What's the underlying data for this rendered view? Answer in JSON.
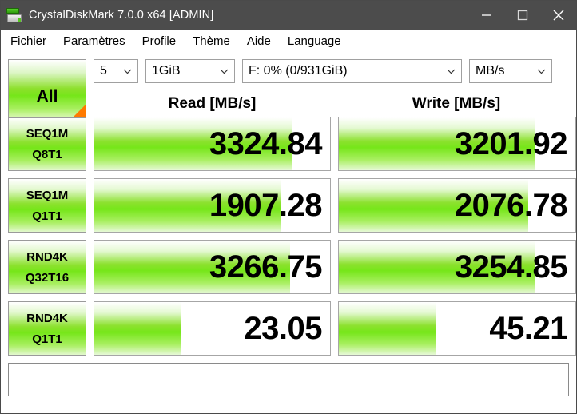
{
  "window": {
    "title": "CrystalDiskMark 7.0.0 x64 [ADMIN]",
    "icon": "disk-drive-icon",
    "controls": {
      "minimize": "minimize-icon",
      "maximize": "maximize-icon",
      "close": "close-icon"
    },
    "titlebar_color": "#4c4c4c"
  },
  "menu": {
    "items": [
      {
        "accel": "F",
        "rest": "ichier"
      },
      {
        "accel": "P",
        "rest": "aramètres"
      },
      {
        "accel": "P",
        "rest": "rofile"
      },
      {
        "accel": "T",
        "rest": "hème"
      },
      {
        "accel": "A",
        "rest": "ide"
      },
      {
        "accel": "L",
        "rest": "anguage"
      }
    ]
  },
  "toolbar": {
    "all_button": "All",
    "runs": "5",
    "test_size": "1GiB",
    "drive": "F: 0% (0/931GiB)",
    "unit": "MB/s"
  },
  "columns": {
    "read": "Read [MB/s]",
    "write": "Write [MB/s]"
  },
  "accent": {
    "green": "#76e619",
    "orange": "#ff7a00"
  },
  "results": [
    {
      "test": "SEQ1M",
      "queue": "Q8T1",
      "read": "3324.84",
      "write": "3201.92",
      "read_fill_pct": 84,
      "write_fill_pct": 83
    },
    {
      "test": "SEQ1M",
      "queue": "Q1T1",
      "read": "1907.28",
      "write": "2076.78",
      "read_fill_pct": 79,
      "write_fill_pct": 80
    },
    {
      "test": "RND4K",
      "queue": "Q32T16",
      "read": "3266.75",
      "write": "3254.85",
      "read_fill_pct": 83,
      "write_fill_pct": 83
    },
    {
      "test": "RND4K",
      "queue": "Q1T1",
      "read": "23.05",
      "write": "45.21",
      "read_fill_pct": 37,
      "write_fill_pct": 41
    }
  ],
  "note": {
    "text": ""
  }
}
